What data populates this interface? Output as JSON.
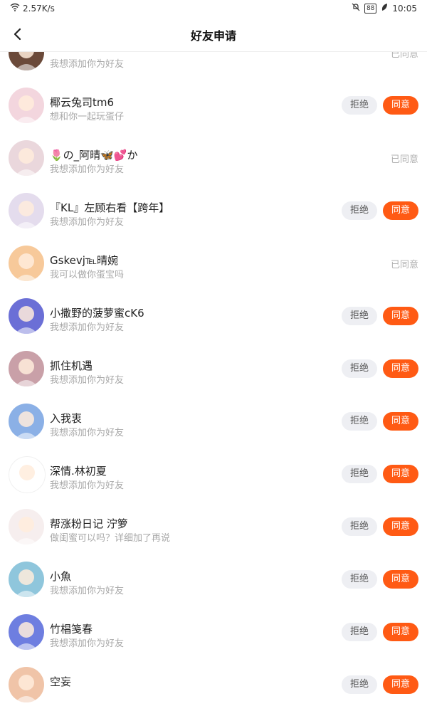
{
  "status_bar": {
    "speed": "2.57K/s",
    "battery": "88",
    "time": "10:05"
  },
  "header": {
    "title": "好友申请"
  },
  "labels": {
    "reject": "拒绝",
    "agree": "同意",
    "agreed": "已同意"
  },
  "requests": [
    {
      "name": "",
      "message": "我想添加你为好友",
      "status": "agreed",
      "avatar_color": "#6b4a3a"
    },
    {
      "name": "椰云兔司tm6",
      "message": "想和你一起玩蛋仔",
      "status": "pending",
      "avatar_color": "#f3d6de"
    },
    {
      "name": "🌷の_阿晴🦋💕か",
      "message": "我想添加你为好友",
      "status": "agreed",
      "avatar_color": "#ead7dc"
    },
    {
      "name": "『KL』左顾右看【跨年】",
      "message": "我想添加你为好友",
      "status": "pending",
      "avatar_color": "#e4dced"
    },
    {
      "name": "Gskevj℡晴婉",
      "message": "我可以做你蛋宝吗",
      "status": "agreed",
      "avatar_color": "#f7c99a"
    },
    {
      "name": "小撒野的菠萝蜜cK6",
      "message": "我想添加你为好友",
      "status": "pending",
      "avatar_color": "#6b6fd6"
    },
    {
      "name": "抓住机遇",
      "message": "我想添加你为好友",
      "status": "pending",
      "avatar_color": "#c9a0a8"
    },
    {
      "name": "入我衷",
      "message": "我想添加你为好友",
      "status": "pending",
      "avatar_color": "#8bb0e6"
    },
    {
      "name": "深情.林初夏",
      "message": "我想添加你为好友",
      "status": "pending",
      "avatar_color": "#ffffff"
    },
    {
      "name": "帮涨粉日记 泞箩",
      "message": "做闺蜜可以吗？详细加了再说",
      "status": "pending",
      "avatar_color": "#f6eeee"
    },
    {
      "name": "小魚",
      "message": "我想添加你为好友",
      "status": "pending",
      "avatar_color": "#8fc6dc"
    },
    {
      "name": "竹椙笺春",
      "message": "我想添加你为好友",
      "status": "pending",
      "avatar_color": "#6e7ee0"
    },
    {
      "name": "空妄",
      "message": "",
      "status": "pending",
      "avatar_color": "#f0c4a8"
    }
  ]
}
